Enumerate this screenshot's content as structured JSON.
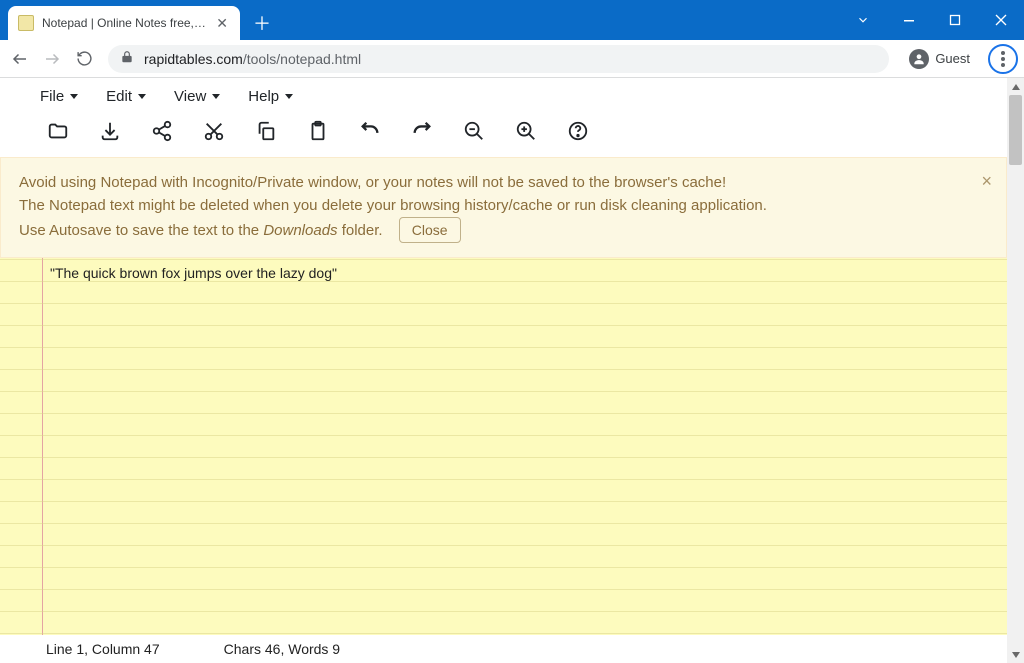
{
  "browser": {
    "tab_title": "Notepad | Online Notes free, no…",
    "url_host": "rapidtables.com",
    "url_path": "/tools/notepad.html",
    "profile_label": "Guest"
  },
  "menubar": {
    "items": [
      "File",
      "Edit",
      "View",
      "Help"
    ]
  },
  "toolbar": {
    "icons": [
      "folder-open",
      "download",
      "share",
      "cut",
      "copy",
      "paste",
      "undo",
      "redo",
      "zoom-out",
      "zoom-in",
      "help"
    ]
  },
  "warning": {
    "line1": "Avoid using Notepad with Incognito/Private window, or your notes will not be saved to the browser's cache!",
    "line2": "The Notepad text might be deleted when you delete your browsing history/cache or run disk cleaning application.",
    "line3_pre": "Use Autosave to save the text to the ",
    "line3_em": "Downloads",
    "line3_post": " folder.",
    "close_label": "Close"
  },
  "note": {
    "text": "\"The quick brown fox jumps over the lazy dog\""
  },
  "status": {
    "position": "Line 1, Column 47",
    "stats": "Chars 46, Words 9"
  }
}
